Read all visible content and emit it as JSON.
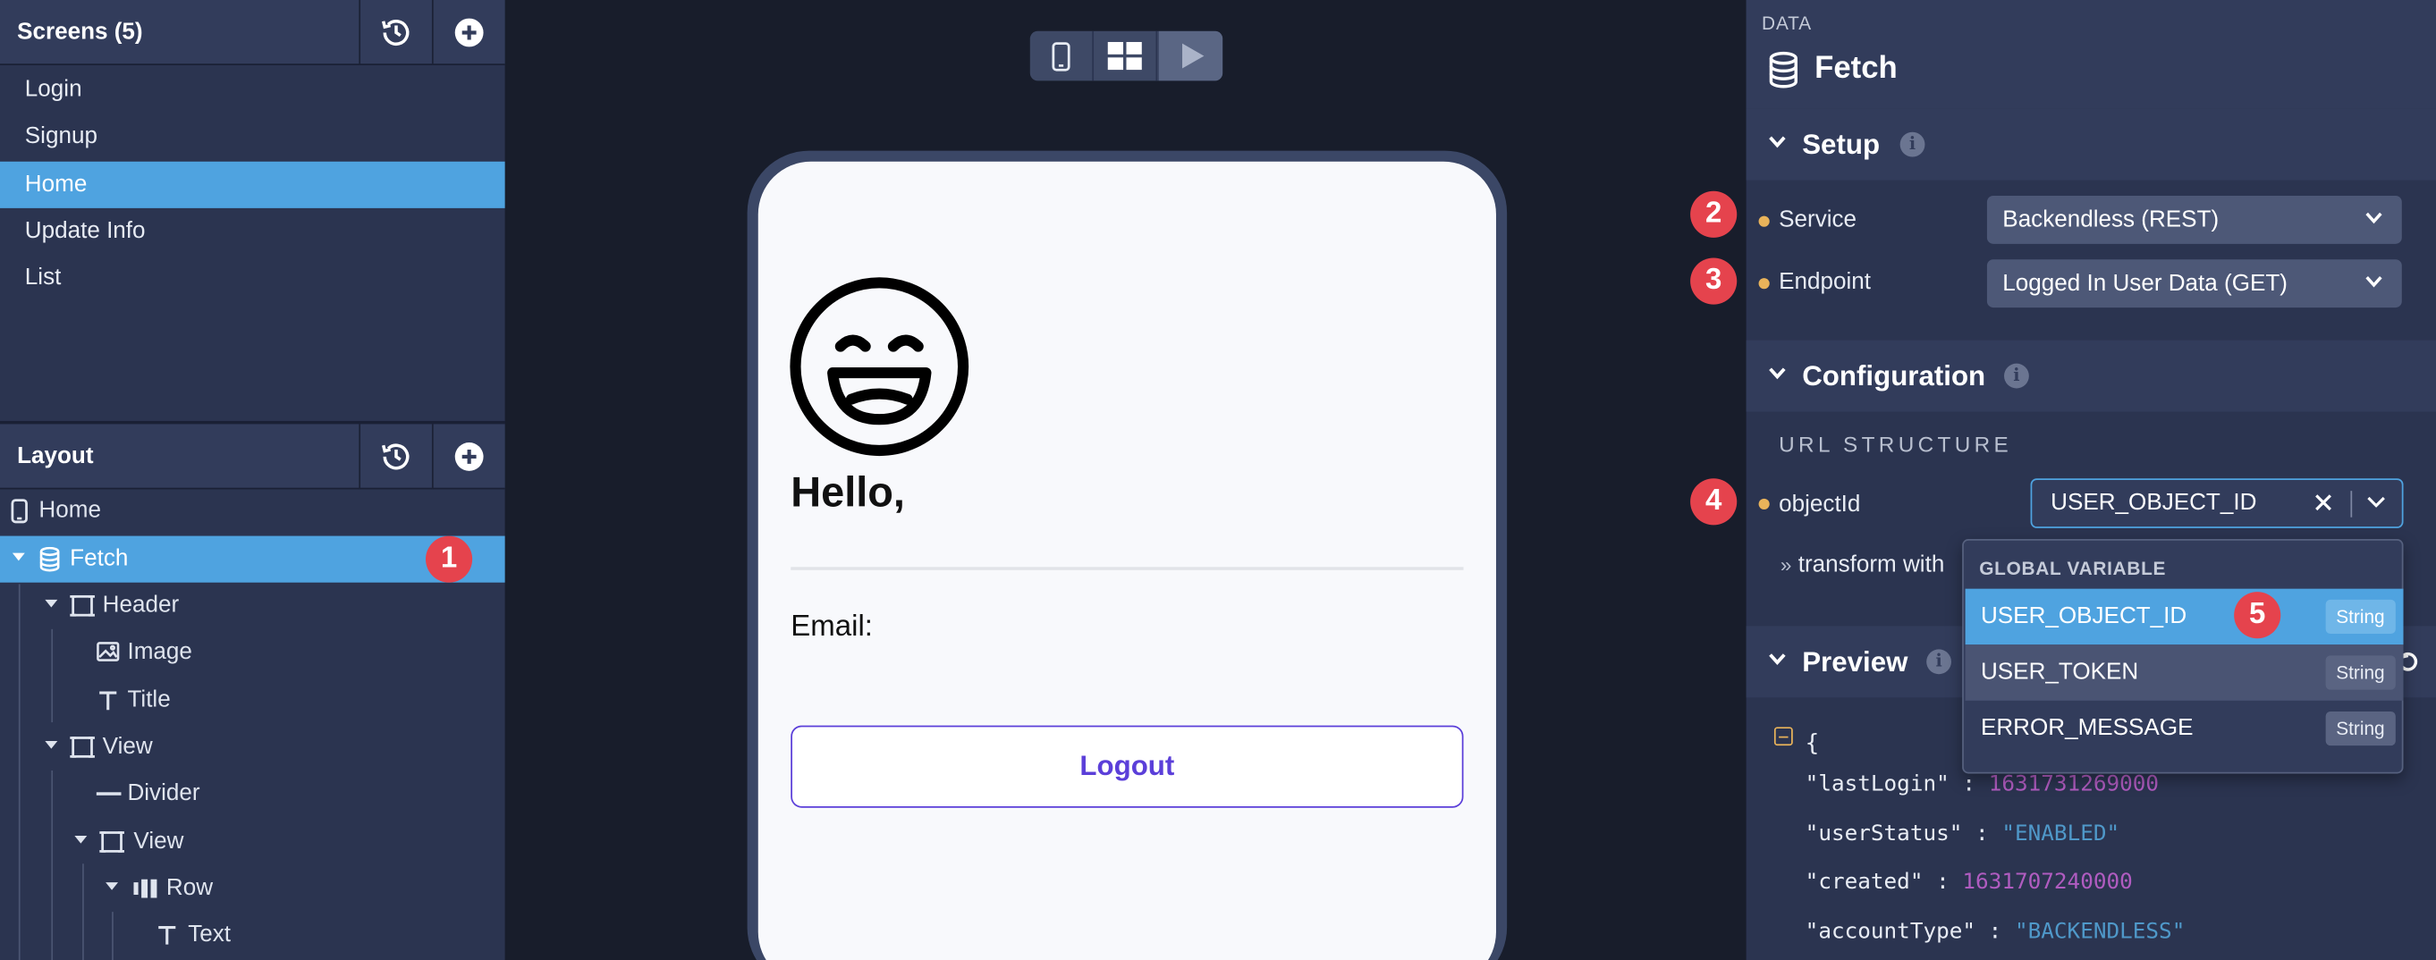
{
  "screens_panel": {
    "title": "Screens (5)",
    "items": [
      "Login",
      "Signup",
      "Home",
      "Update Info",
      "List"
    ],
    "selected": "Home"
  },
  "layout_panel": {
    "title": "Layout",
    "tree": [
      {
        "label": "Home",
        "icon": "phone-icon"
      },
      {
        "label": "Fetch",
        "icon": "database-icon"
      },
      {
        "label": "Header",
        "icon": "view-icon"
      },
      {
        "label": "Image",
        "icon": "image-icon"
      },
      {
        "label": "Title",
        "icon": "text-icon"
      },
      {
        "label": "View",
        "icon": "view-icon"
      },
      {
        "label": "Divider",
        "icon": "divider-icon"
      },
      {
        "label": "View",
        "icon": "view-icon"
      },
      {
        "label": "Row",
        "icon": "row-icon"
      },
      {
        "label": "Text",
        "icon": "text-icon"
      }
    ],
    "selected": "Fetch"
  },
  "badges": [
    "1",
    "2",
    "3",
    "4",
    "5"
  ],
  "canvas": {
    "hello_text": "Hello,",
    "email_label": "Email:",
    "logout_label": "Logout"
  },
  "inspector": {
    "category": "DATA",
    "title": "Fetch",
    "setup": {
      "title": "Setup",
      "service_label": "Service",
      "service_value": "Backendless (REST)",
      "endpoint_label": "Endpoint",
      "endpoint_value": "Logged In User Data (GET)"
    },
    "configuration": {
      "title": "Configuration",
      "url_structure": "URL STRUCTURE",
      "objectid_label": "objectId",
      "objectid_value": "USER_OBJECT_ID",
      "transform_label": "transform with"
    },
    "preview": {
      "title": "Preview",
      "open_brace": "{",
      "json_lines": [
        {
          "key": "\"lastLogin\"",
          "value": "1631731269000",
          "kind": "number"
        },
        {
          "key": "\"userStatus\"",
          "value": "\"ENABLED\"",
          "kind": "string"
        },
        {
          "key": "\"created\"",
          "value": "1631707240000",
          "kind": "number"
        },
        {
          "key": "\"accountType\"",
          "value": "\"BACKENDLESS\"",
          "kind": "string"
        }
      ]
    }
  },
  "dropdown": {
    "header": "GLOBAL VARIABLE",
    "options": [
      {
        "name": "USER_OBJECT_ID",
        "type": "String"
      },
      {
        "name": "USER_TOKEN",
        "type": "String"
      },
      {
        "name": "ERROR_MESSAGE",
        "type": "String"
      }
    ],
    "selected": "USER_OBJECT_ID"
  },
  "colors": {
    "accent": "#4fa3e0",
    "badge": "#e5434d",
    "logout_border": "#5b3fd9",
    "required_dot": "#e9b35a"
  }
}
